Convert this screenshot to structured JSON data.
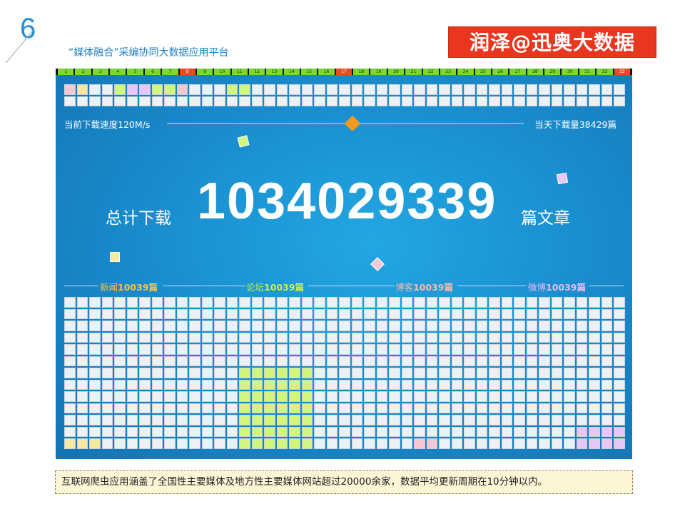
{
  "header": {
    "slide_number": "6",
    "subtitle": "“媒体融合”采编协同大数据应用平台",
    "brand": "润泽@迅奥大数据"
  },
  "strip": {
    "numbers": [
      "1",
      "2",
      "3",
      "4",
      "5",
      "6",
      "7",
      "8",
      "9",
      "10",
      "11",
      "12",
      "13",
      "14",
      "15",
      "16",
      "17",
      "18",
      "19",
      "20",
      "21",
      "22",
      "23",
      "24",
      "25",
      "26",
      "27",
      "28",
      "29",
      "30",
      "31",
      "32",
      "33"
    ],
    "highlighted": [
      "8",
      "17",
      "33"
    ],
    "color_normal": "#7bd63a",
    "color_highlight": "#e84a2a"
  },
  "stats": {
    "speed_label": "当前下载速度120M/s",
    "today_label": "当天下载量38429篇",
    "total_label": "总计下载",
    "total_value": "1034029339",
    "total_unit": "篇文章"
  },
  "categories": [
    {
      "name": "新闻",
      "count": "10039篇",
      "color": "#f2c24a"
    },
    {
      "name": "论坛",
      "count": "10039篇",
      "color": "#c9ef4a"
    },
    {
      "name": "博客",
      "count": "10039篇",
      "color": "#f6b9b0"
    },
    {
      "name": "微博",
      "count": "10039篇",
      "color": "#e8b9f2"
    }
  ],
  "colors": {
    "panel_blue": "#1a8fcf",
    "brand_red": "#e8361f",
    "accent_orange": "#f39a20",
    "cell_default": "#eef1f4",
    "green_block": "#d2f57e",
    "pink": "#f8c8d0",
    "yellow": "#fbe7a0",
    "purple": "#e9c6f5"
  },
  "footer": {
    "text": "互联网爬虫应用涵盖了全国性主要媒体及地方性主要媒体网站超过20000余家，数据平均更新周期在10分钟以内。"
  }
}
